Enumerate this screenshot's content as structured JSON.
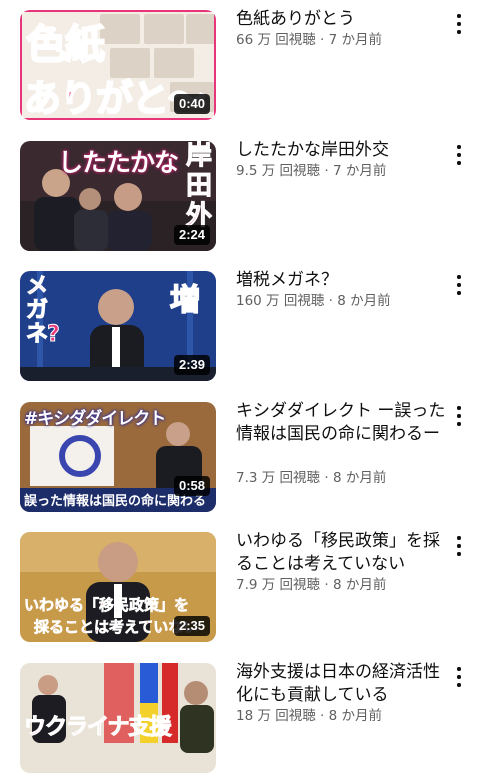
{
  "videos": [
    {
      "title": "色紙ありがとう",
      "views": "66 万 回視聴",
      "age": "7 か月前",
      "duration": "0:40",
      "thumb_caption_1": "色紙",
      "thumb_caption_2": "ありがと〜"
    },
    {
      "title": "したたかな岸田外交",
      "views": "9.5 万 回視聴",
      "age": "7 か月前",
      "duration": "2:24",
      "thumb_caption_1": "したたかな",
      "thumb_caption_2": "岸田外"
    },
    {
      "title": "増税メガネ？",
      "views": "160 万 回視聴",
      "age": "8 か月前",
      "duration": "2:39",
      "thumb_caption_1": "メガネ?",
      "thumb_caption_2": "増"
    },
    {
      "title": "キシダダイレクト ー誤った情報は国民の命に関わるー",
      "views": "7.3 万 回視聴",
      "age": "8 か月前",
      "duration": "0:58",
      "thumb_caption_1": "#キシダダイレクト",
      "thumb_caption_2": "誤った情報は国民の命に関わる"
    },
    {
      "title": "いわゆる「移民政策」を採ることは考えていない",
      "views": "7.9 万 回視聴",
      "age": "8 か月前",
      "duration": "2:35",
      "thumb_caption_1": "いわゆる「移民政策」を",
      "thumb_caption_2": "採ることは考えていない"
    },
    {
      "title": "海外支援は日本の経済活性化にも貢献している",
      "views": "18 万 回視聴",
      "age": "8 か月前",
      "duration": "",
      "thumb_caption_1": "ウクライナ支援",
      "thumb_caption_2": ""
    }
  ],
  "separator": " · ",
  "colors": {
    "pink": "#e8357a",
    "meta": "#606060",
    "title": "#0f0f0f"
  }
}
